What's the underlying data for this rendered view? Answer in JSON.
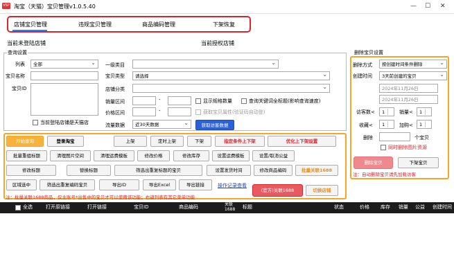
{
  "window": {
    "logo": "VSP",
    "title": "淘宝（天猫）宝贝管理v1.0.5.40",
    "min": "—",
    "max": "☐",
    "close": "✕"
  },
  "tabs": [
    {
      "label": "店铺宝贝管理"
    },
    {
      "label": "违规宝贝管理"
    },
    {
      "label": "商品编码管理"
    },
    {
      "label": "下架恢复"
    }
  ],
  "sub": {
    "unlogged": "当前未登陆店铺",
    "authorized": "当前授权店铺"
  },
  "query": {
    "group": "查询设置",
    "list_label": "列表",
    "list_value": "全部",
    "name_label": "宝贝名称",
    "id_label": "宝贝ID",
    "tmall_check": "当前登陆店铺是天猫店",
    "cat1_label": "一级类目",
    "type_label": "宝贝类型",
    "type_value": "请选择",
    "shopcat_label": "店铺分类",
    "sales_label": "销量区间",
    "price_label": "价格区间",
    "dash": "-",
    "show_spec": "显示规格数量",
    "query_full": "查询关键词全标题(影响查询速度)",
    "get_attr": "获取宝贝属性(验证码自动登)",
    "traffic_label": "流量数据",
    "traffic_value": "近30天数据",
    "traffic_btn": "获取访客数据"
  },
  "del": {
    "group": "删除宝贝设置",
    "mode_label": "删除方式",
    "mode_value": "按创建时间条件删除",
    "ctime_label": "创建时间",
    "ctime_value": "3天前创建的宝贝",
    "date1": "2024年11月26日",
    "date2": "2024年11月26日",
    "visitor_label": "访客数<",
    "visitor_value": "1",
    "sales_label": "销量<",
    "sales_value": "1",
    "fav_label": "收藏<",
    "fav_value": "1",
    "cart_label": "加购<",
    "cart_value": "1",
    "del_label": "删除",
    "del_unit": "个宝贝",
    "del_img": "同时删除图片资源",
    "del_btn": "删除宝贝",
    "offshelf_btn": "下架宝贝",
    "note": "注：自动删除宝贝请先加载访客"
  },
  "actions": {
    "row1": [
      "开始查询",
      "登录淘宝",
      "上架",
      "定时上架",
      "下架",
      "指定条件上下架",
      "优化上下架设置"
    ],
    "row2": [
      "批量重组标题",
      "清理图片空间",
      "清理运费模板",
      "修改价格",
      "修改库存",
      "设置运费模板",
      "设置/取消公益"
    ],
    "row3": [
      "修改标题",
      "替换标题",
      "筛选出重复标题的宝贝",
      "设置发货时间",
      "修改商品编码",
      "批量关联1688"
    ],
    "row4": [
      "区域选中",
      "筛选出重复编码宝贝",
      "导出ID",
      "导出Excel",
      "导出链接",
      "操作记录查看",
      "(官方)关联1688",
      "切换店铺"
    ],
    "note": "注：批量关联1688商品，仅主账号*出售中的宝贝才可以使用该功能；右键列表有其它菜单功能"
  },
  "table": {
    "headers": [
      "全选",
      "打开原链接",
      "打开链接",
      "宝贝ID",
      "商品编码",
      "关联1688",
      "标题",
      "状态",
      "价格",
      "库存",
      "销量",
      "公益",
      "创建时间"
    ]
  },
  "colors": {
    "accent": "#2a7cff",
    "danger": "#d9242b",
    "highlight": "#f5a623",
    "header_bg": "#1c1c1c"
  }
}
